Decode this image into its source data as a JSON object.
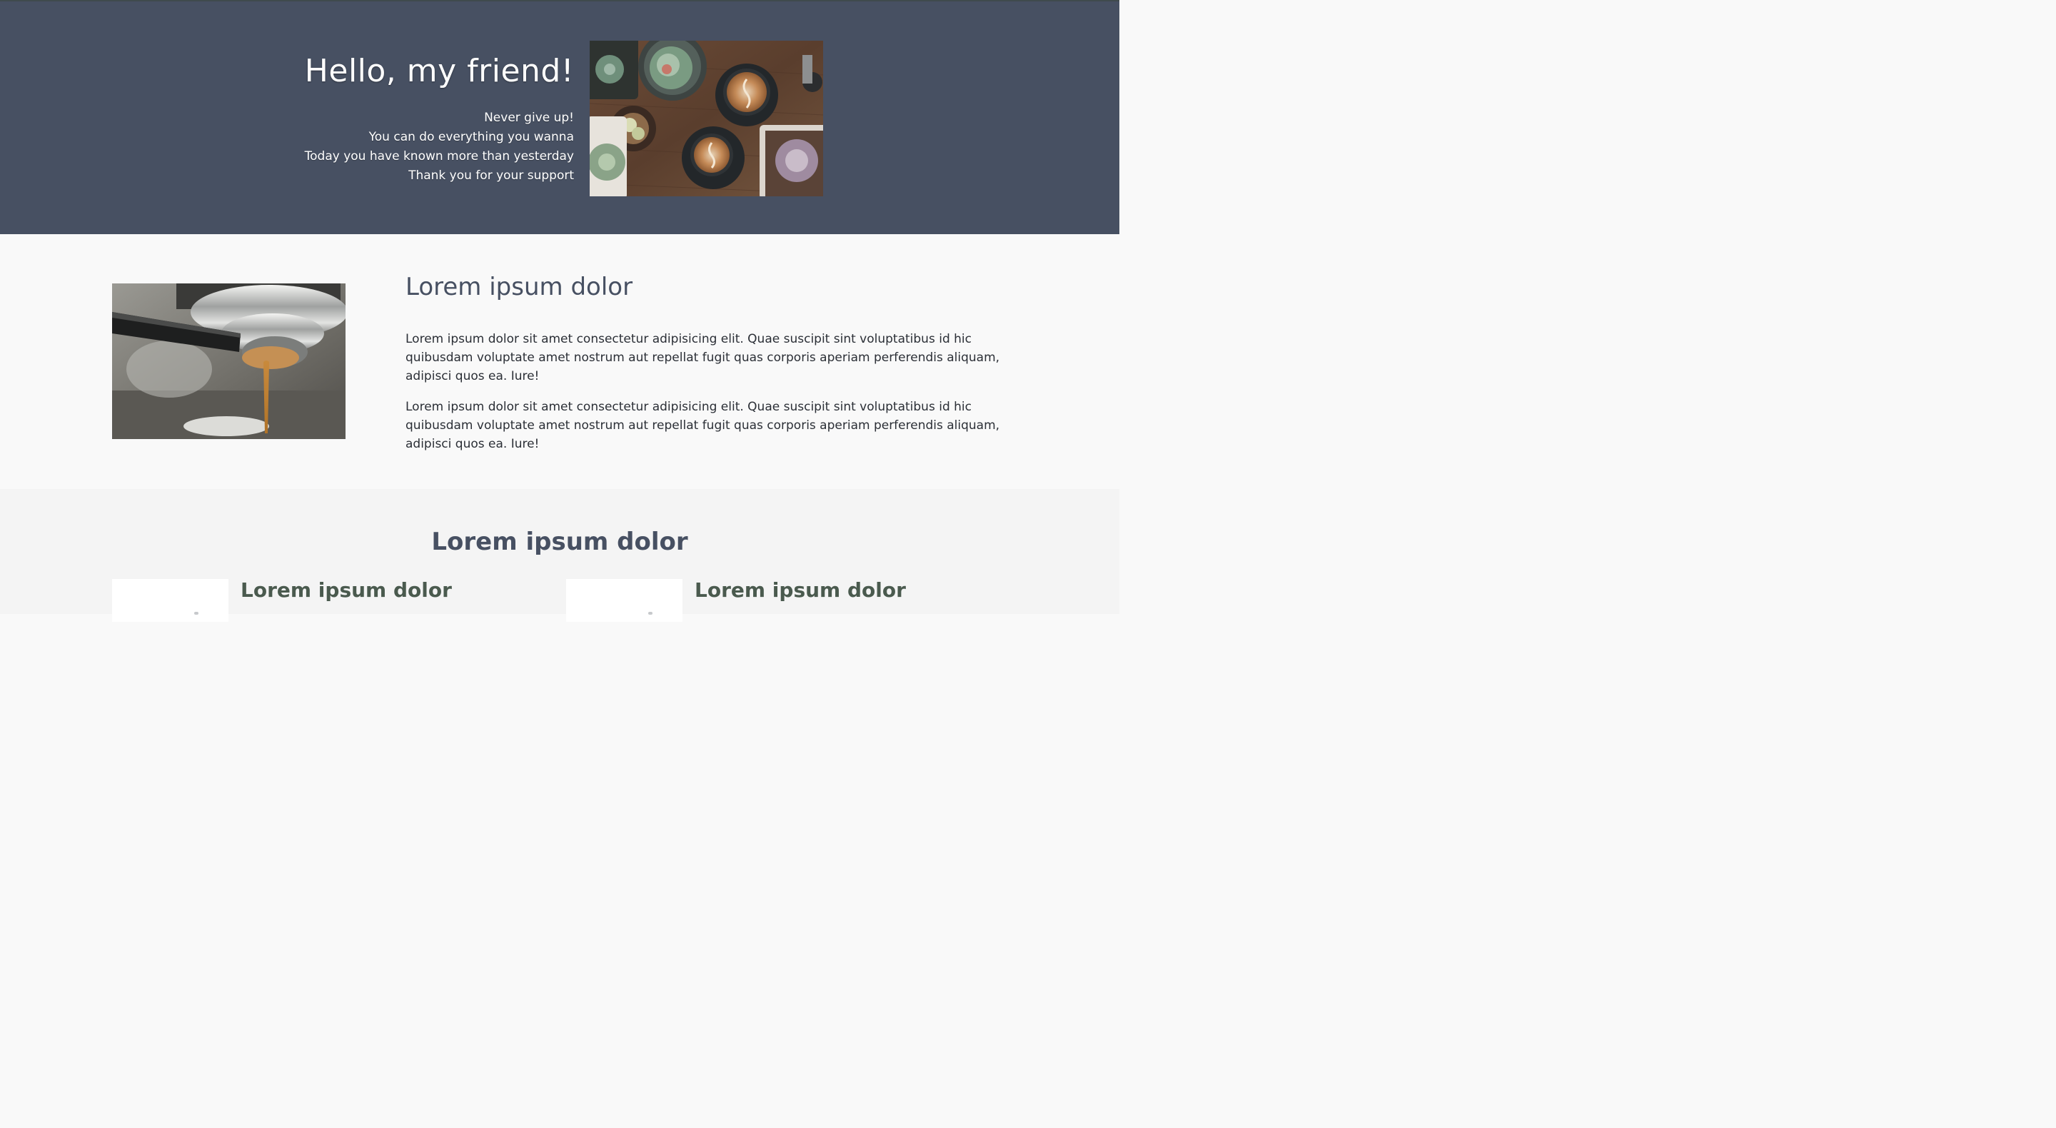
{
  "hero": {
    "title": "Hello, my friend!",
    "lines": [
      "Never give up!",
      "You can do everything you wanna",
      "Today you have known more than yesterday",
      "Thank you for your support"
    ],
    "background_color": "#475062",
    "image_icon": "coffee-table-photo"
  },
  "about": {
    "title": "Lorem ipsum dolor",
    "paragraphs": [
      "Lorem ipsum dolor sit amet consectetur adipisicing elit. Quae suscipit sint voluptatibus id hic quibusdam voluptate amet nostrum aut repellat fugit quas corporis aperiam perferendis aliquam, adipisci quos ea. Iure!",
      "Lorem ipsum dolor sit amet consectetur adipisicing elit. Quae suscipit sint voluptatibus id hic quibusdam voluptate amet nostrum aut repellat fugit quas corporis aperiam perferendis aliquam, adipisci quos ea. Iure!"
    ],
    "image_icon": "espresso-machine-photo"
  },
  "services": {
    "title": "Lorem ipsum dolor",
    "cards": [
      {
        "title": "Lorem ipsum dolor"
      },
      {
        "title": "Lorem ipsum dolor"
      }
    ]
  }
}
